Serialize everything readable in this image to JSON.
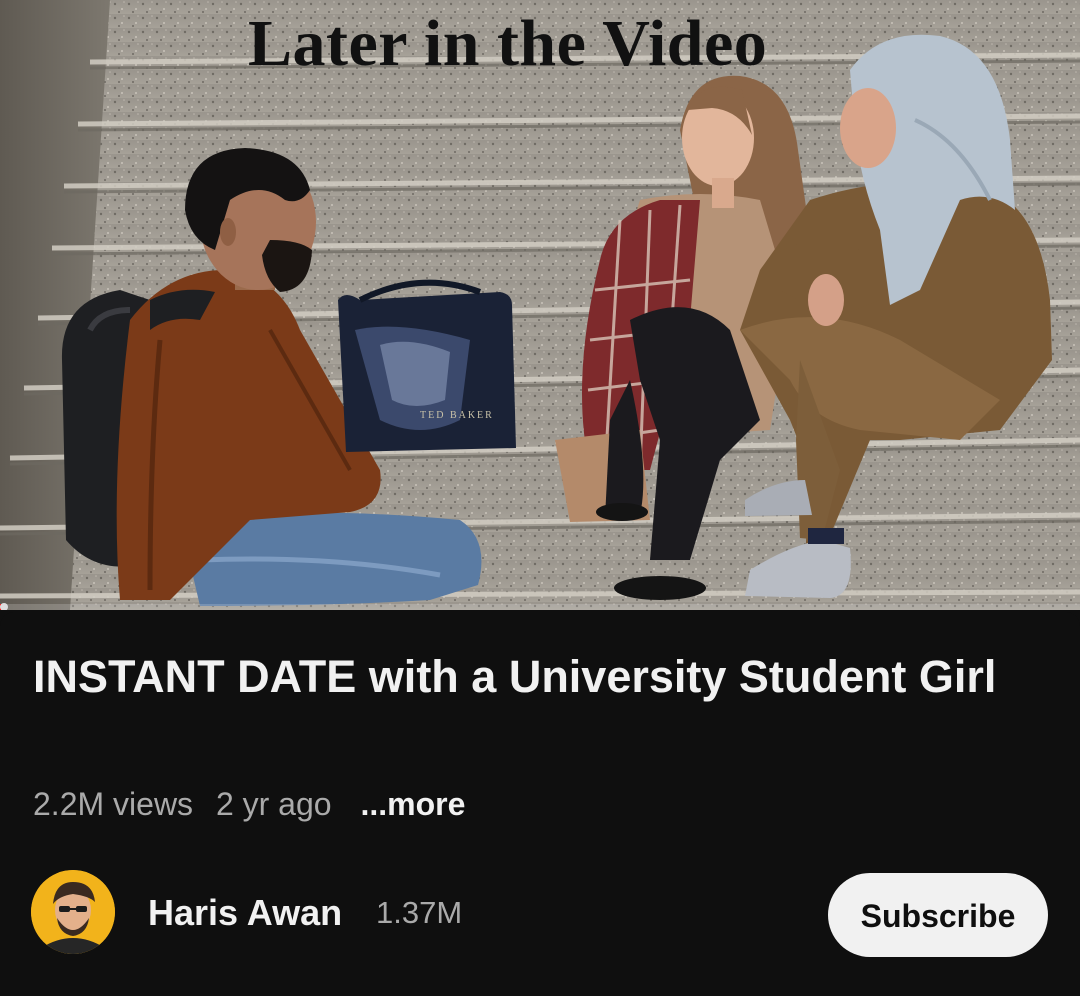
{
  "video": {
    "overlay_caption": "Later in the Video",
    "progress_fraction": 0.003,
    "bag_brand": "TED BAKER",
    "scene_description_icon": "video-frame"
  },
  "details": {
    "title": "INSTANT DATE with a University Student Girl",
    "views": "2.2M views",
    "age": "2 yr ago",
    "more_label": "...more"
  },
  "channel": {
    "name": "Haris Awan",
    "subscribers": "1.37M",
    "avatar_icon": "channel-avatar-icon"
  },
  "actions": {
    "subscribe_label": "Subscribe"
  },
  "colors": {
    "background": "#0f0f0f",
    "primary_text": "#f1f1f1",
    "secondary_text": "#aaaaaa",
    "subscribe_bg": "#f1f1f1",
    "progress": "#ff0000"
  }
}
